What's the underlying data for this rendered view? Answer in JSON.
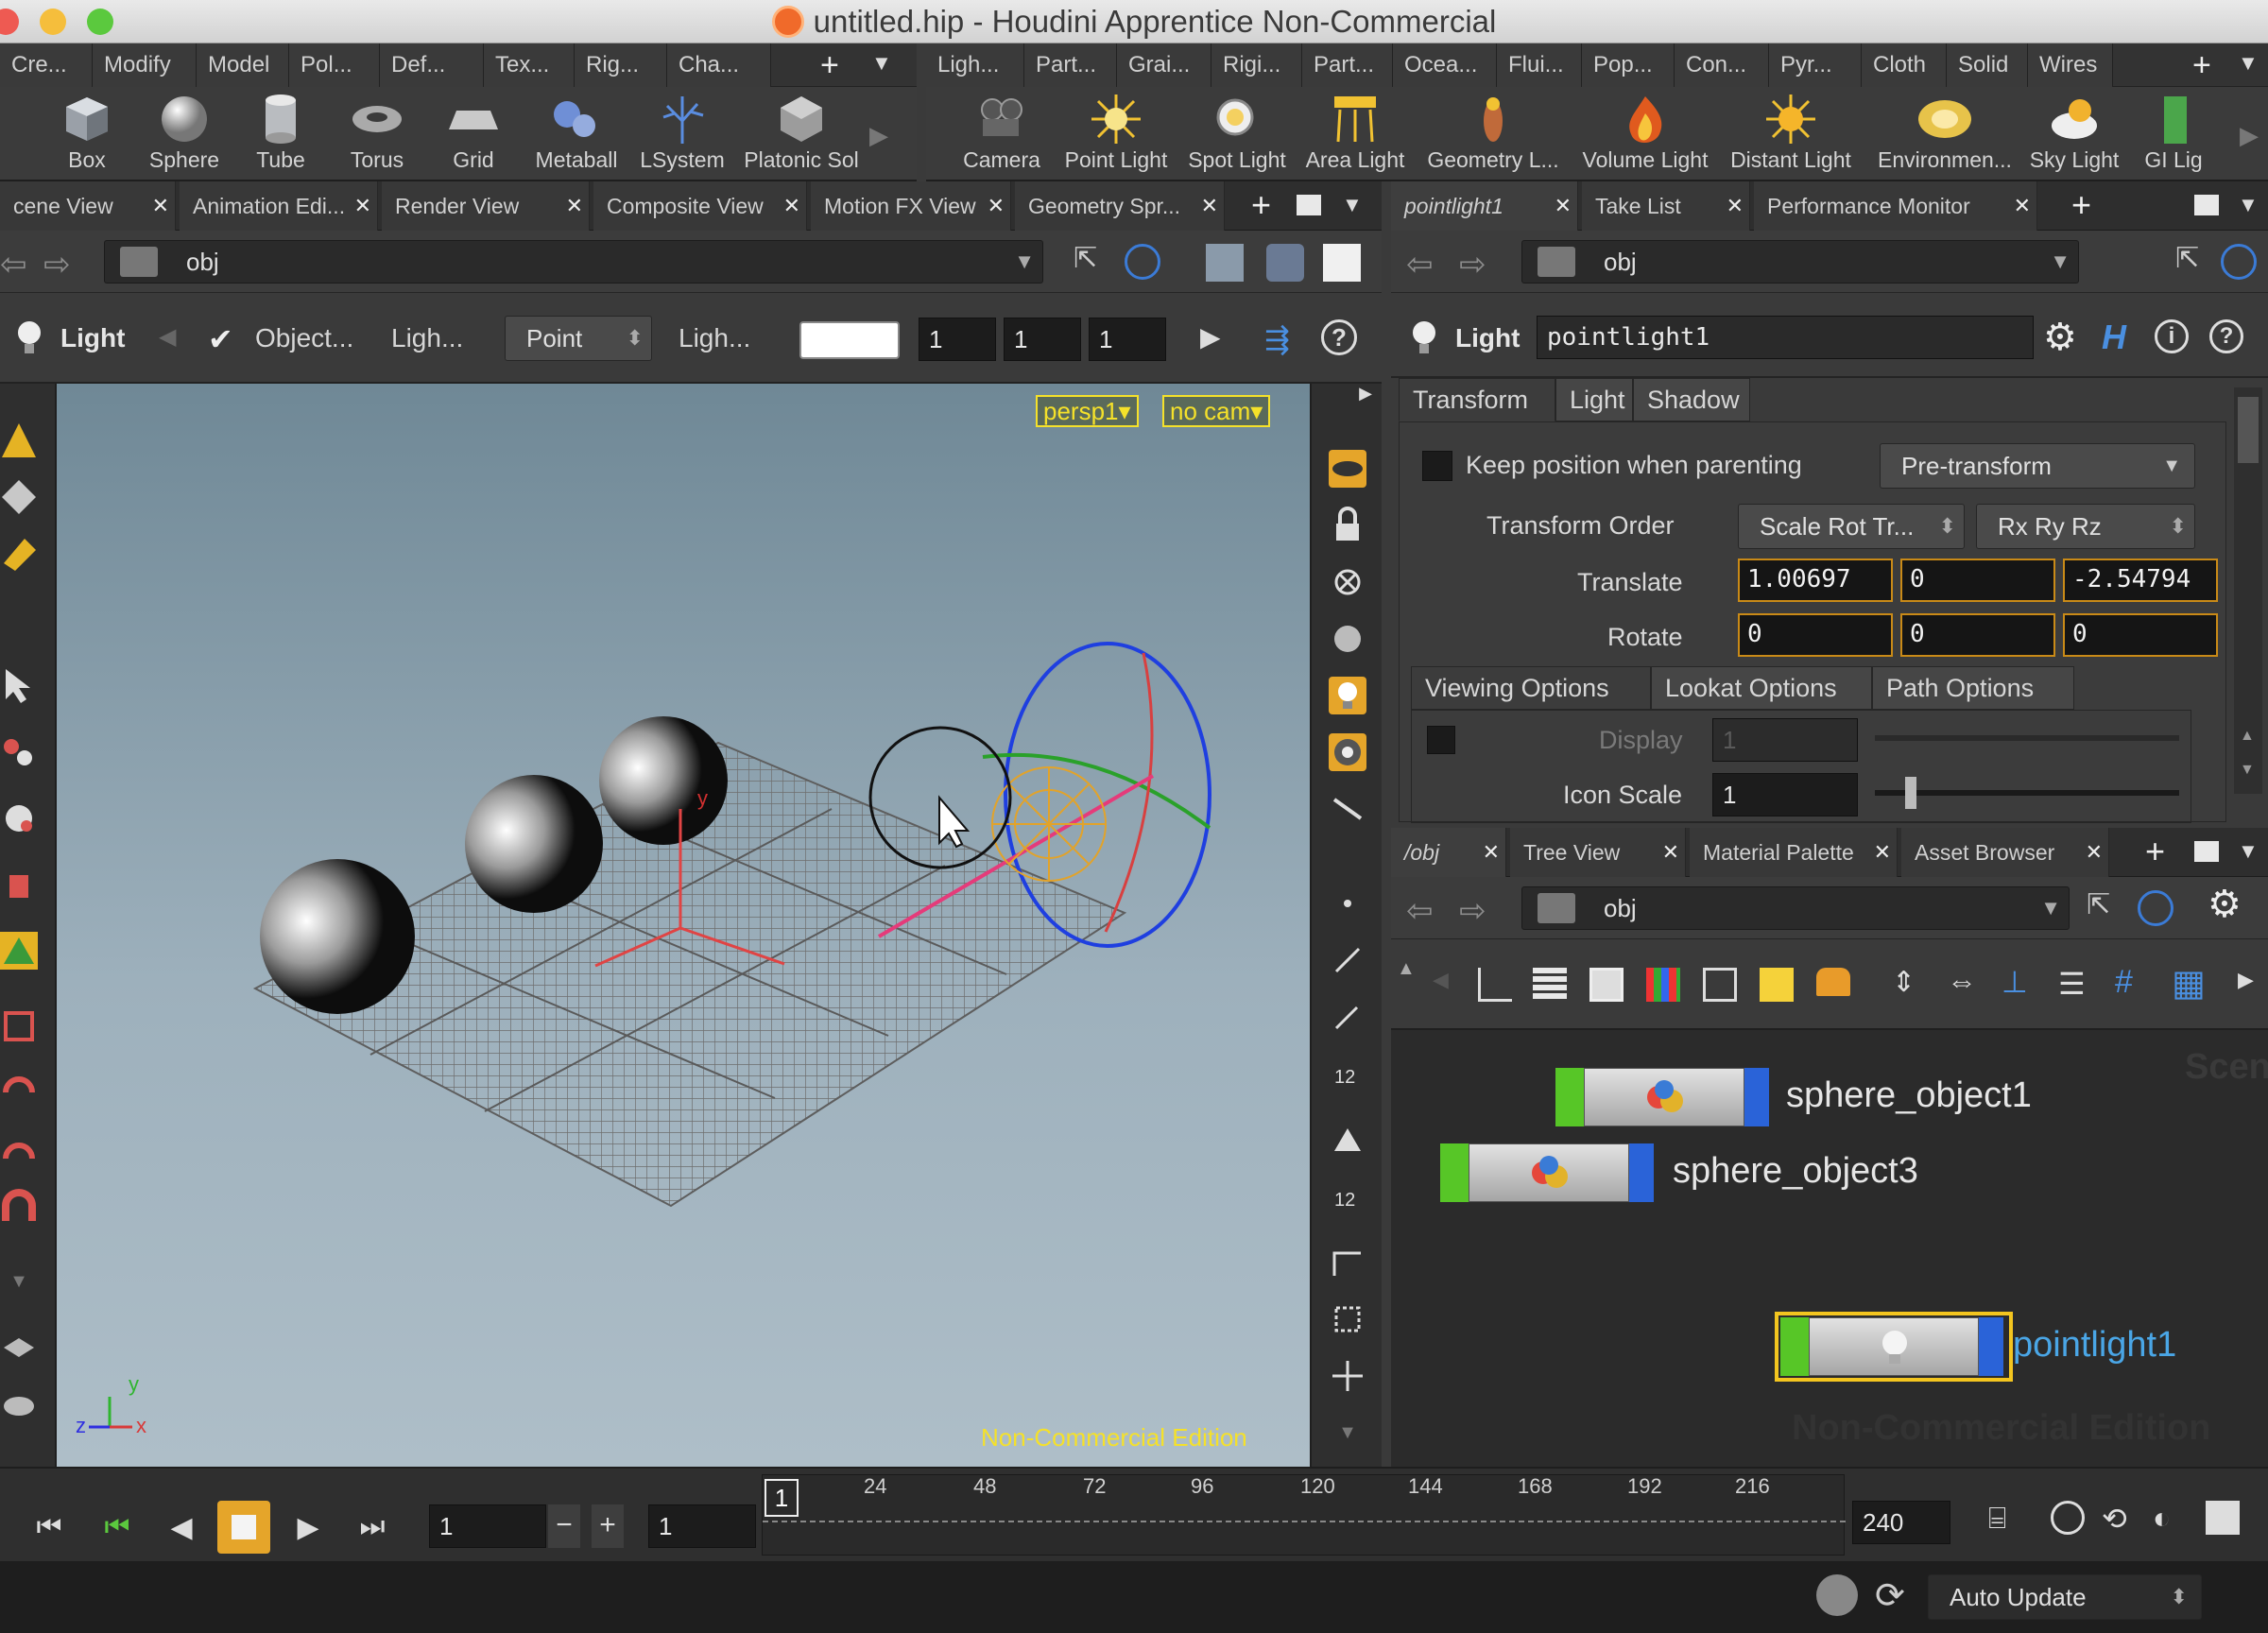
{
  "window": {
    "title": "untitled.hip - Houdini Apprentice Non-Commercial"
  },
  "shelf_left": {
    "tabs": [
      "Cre...",
      "Modify",
      "Model",
      "Pol...",
      "Def...",
      "Tex...",
      "Rig...",
      "Cha..."
    ],
    "tools": [
      "Box",
      "Sphere",
      "Tube",
      "Torus",
      "Grid",
      "Metaball",
      "LSystem",
      "Platonic Sol"
    ]
  },
  "shelf_right": {
    "tabs": [
      "Ligh...",
      "Part...",
      "Grai...",
      "Rigi...",
      "Part...",
      "Ocea...",
      "Flui...",
      "Pop...",
      "Con...",
      "Pyr...",
      "Cloth",
      "Solid",
      "Wires"
    ],
    "tools": [
      "Camera",
      "Point Light",
      "Spot Light",
      "Area Light",
      "Geometry L...",
      "Volume Light",
      "Distant Light",
      "Environmen...",
      "Sky Light",
      "GI Lig"
    ]
  },
  "viewer": {
    "tabs": [
      "cene View",
      "Animation Edi...",
      "Render View",
      "Composite View",
      "Motion FX View",
      "Geometry Spr..."
    ],
    "path": "obj",
    "toolbar": {
      "context": "Light",
      "object_label": "Object...",
      "ligh1": "Ligh...",
      "light_type": "Point",
      "ligh2": "Ligh...",
      "v1": "1",
      "v2": "1",
      "v3": "1"
    },
    "camera_menu": "persp1▾",
    "cam_menu": "no cam▾",
    "watermark": "Non-Commercial Edition",
    "axis": {
      "y": "y",
      "z": "z",
      "x": "x"
    }
  },
  "params": {
    "tabs": [
      "pointlight1",
      "Take List",
      "Performance Monitor"
    ],
    "path": "obj",
    "node_type": "Light",
    "node_name": "pointlight1",
    "sub_tabs": [
      "Transform",
      "Light",
      "Shadow"
    ],
    "keep_position_label": "Keep position when parenting",
    "pre_transform": "Pre-transform",
    "transform_order_label": "Transform Order",
    "transform_order": "Scale Rot Tr...",
    "rot_order": "Rx Ry Rz",
    "translate_label": "Translate",
    "translate": [
      "1.00697",
      "0",
      "-2.54794"
    ],
    "rotate_label": "Rotate",
    "rotate": [
      "0",
      "0",
      "0"
    ],
    "opt_tabs": [
      "Viewing Options",
      "Lookat Options",
      "Path Options"
    ],
    "display_label": "Display",
    "display_value": "1",
    "icon_scale_label": "Icon Scale",
    "icon_scale_value": "1"
  },
  "network": {
    "tabs": [
      "/obj",
      "Tree View",
      "Material Palette",
      "Asset Browser"
    ],
    "path": "obj",
    "scene_label": "Scene",
    "nodes": [
      "sphere_object1",
      "sphere_object3",
      "pointlight1"
    ],
    "watermark": "Non-Commercial Edition"
  },
  "timeline": {
    "frame": "1",
    "start": "1",
    "end": "240",
    "current": "1",
    "ticks": [
      "24",
      "48",
      "72",
      "96",
      "120",
      "144",
      "168",
      "192",
      "216"
    ]
  },
  "status": {
    "auto_update": "Auto Update"
  }
}
